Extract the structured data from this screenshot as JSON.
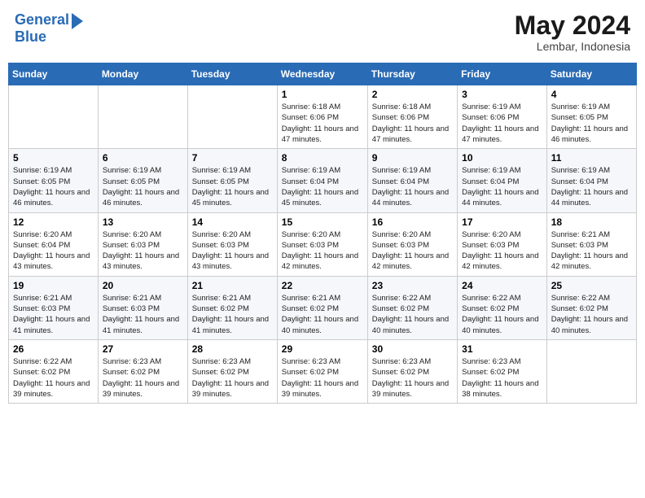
{
  "header": {
    "logo_line1": "General",
    "logo_line2": "Blue",
    "title": "May 2024",
    "subtitle": "Lembar, Indonesia"
  },
  "calendar": {
    "weekdays": [
      "Sunday",
      "Monday",
      "Tuesday",
      "Wednesday",
      "Thursday",
      "Friday",
      "Saturday"
    ],
    "rows": [
      [
        {
          "day": "",
          "info": ""
        },
        {
          "day": "",
          "info": ""
        },
        {
          "day": "",
          "info": ""
        },
        {
          "day": "1",
          "info": "Sunrise: 6:18 AM\nSunset: 6:06 PM\nDaylight: 11 hours and 47 minutes."
        },
        {
          "day": "2",
          "info": "Sunrise: 6:18 AM\nSunset: 6:06 PM\nDaylight: 11 hours and 47 minutes."
        },
        {
          "day": "3",
          "info": "Sunrise: 6:19 AM\nSunset: 6:06 PM\nDaylight: 11 hours and 47 minutes."
        },
        {
          "day": "4",
          "info": "Sunrise: 6:19 AM\nSunset: 6:05 PM\nDaylight: 11 hours and 46 minutes."
        }
      ],
      [
        {
          "day": "5",
          "info": "Sunrise: 6:19 AM\nSunset: 6:05 PM\nDaylight: 11 hours and 46 minutes."
        },
        {
          "day": "6",
          "info": "Sunrise: 6:19 AM\nSunset: 6:05 PM\nDaylight: 11 hours and 46 minutes."
        },
        {
          "day": "7",
          "info": "Sunrise: 6:19 AM\nSunset: 6:05 PM\nDaylight: 11 hours and 45 minutes."
        },
        {
          "day": "8",
          "info": "Sunrise: 6:19 AM\nSunset: 6:04 PM\nDaylight: 11 hours and 45 minutes."
        },
        {
          "day": "9",
          "info": "Sunrise: 6:19 AM\nSunset: 6:04 PM\nDaylight: 11 hours and 44 minutes."
        },
        {
          "day": "10",
          "info": "Sunrise: 6:19 AM\nSunset: 6:04 PM\nDaylight: 11 hours and 44 minutes."
        },
        {
          "day": "11",
          "info": "Sunrise: 6:19 AM\nSunset: 6:04 PM\nDaylight: 11 hours and 44 minutes."
        }
      ],
      [
        {
          "day": "12",
          "info": "Sunrise: 6:20 AM\nSunset: 6:04 PM\nDaylight: 11 hours and 43 minutes."
        },
        {
          "day": "13",
          "info": "Sunrise: 6:20 AM\nSunset: 6:03 PM\nDaylight: 11 hours and 43 minutes."
        },
        {
          "day": "14",
          "info": "Sunrise: 6:20 AM\nSunset: 6:03 PM\nDaylight: 11 hours and 43 minutes."
        },
        {
          "day": "15",
          "info": "Sunrise: 6:20 AM\nSunset: 6:03 PM\nDaylight: 11 hours and 42 minutes."
        },
        {
          "day": "16",
          "info": "Sunrise: 6:20 AM\nSunset: 6:03 PM\nDaylight: 11 hours and 42 minutes."
        },
        {
          "day": "17",
          "info": "Sunrise: 6:20 AM\nSunset: 6:03 PM\nDaylight: 11 hours and 42 minutes."
        },
        {
          "day": "18",
          "info": "Sunrise: 6:21 AM\nSunset: 6:03 PM\nDaylight: 11 hours and 42 minutes."
        }
      ],
      [
        {
          "day": "19",
          "info": "Sunrise: 6:21 AM\nSunset: 6:03 PM\nDaylight: 11 hours and 41 minutes."
        },
        {
          "day": "20",
          "info": "Sunrise: 6:21 AM\nSunset: 6:03 PM\nDaylight: 11 hours and 41 minutes."
        },
        {
          "day": "21",
          "info": "Sunrise: 6:21 AM\nSunset: 6:02 PM\nDaylight: 11 hours and 41 minutes."
        },
        {
          "day": "22",
          "info": "Sunrise: 6:21 AM\nSunset: 6:02 PM\nDaylight: 11 hours and 40 minutes."
        },
        {
          "day": "23",
          "info": "Sunrise: 6:22 AM\nSunset: 6:02 PM\nDaylight: 11 hours and 40 minutes."
        },
        {
          "day": "24",
          "info": "Sunrise: 6:22 AM\nSunset: 6:02 PM\nDaylight: 11 hours and 40 minutes."
        },
        {
          "day": "25",
          "info": "Sunrise: 6:22 AM\nSunset: 6:02 PM\nDaylight: 11 hours and 40 minutes."
        }
      ],
      [
        {
          "day": "26",
          "info": "Sunrise: 6:22 AM\nSunset: 6:02 PM\nDaylight: 11 hours and 39 minutes."
        },
        {
          "day": "27",
          "info": "Sunrise: 6:23 AM\nSunset: 6:02 PM\nDaylight: 11 hours and 39 minutes."
        },
        {
          "day": "28",
          "info": "Sunrise: 6:23 AM\nSunset: 6:02 PM\nDaylight: 11 hours and 39 minutes."
        },
        {
          "day": "29",
          "info": "Sunrise: 6:23 AM\nSunset: 6:02 PM\nDaylight: 11 hours and 39 minutes."
        },
        {
          "day": "30",
          "info": "Sunrise: 6:23 AM\nSunset: 6:02 PM\nDaylight: 11 hours and 39 minutes."
        },
        {
          "day": "31",
          "info": "Sunrise: 6:23 AM\nSunset: 6:02 PM\nDaylight: 11 hours and 38 minutes."
        },
        {
          "day": "",
          "info": ""
        }
      ]
    ]
  }
}
